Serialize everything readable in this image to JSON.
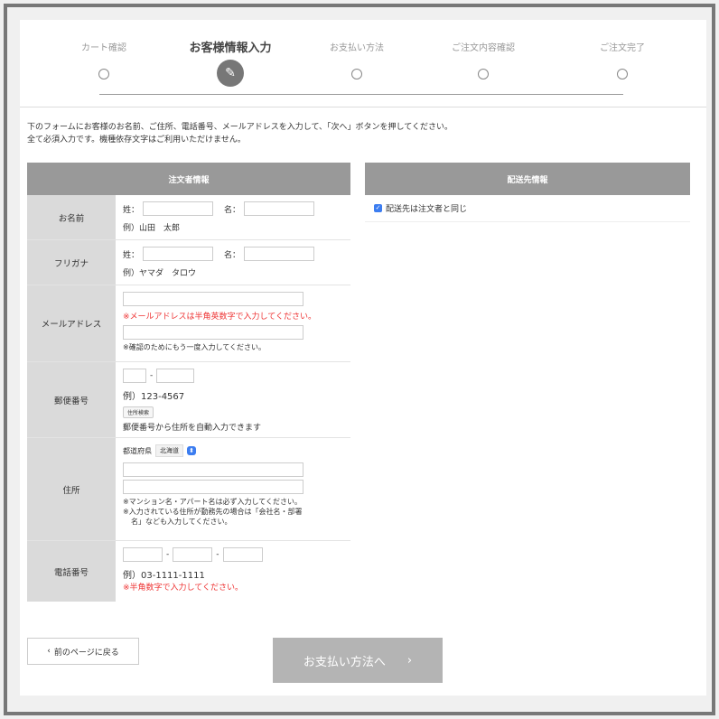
{
  "steps": [
    {
      "label": "カート確認"
    },
    {
      "label": "お客様情報入力"
    },
    {
      "label": "お支払い方法"
    },
    {
      "label": "ご注文内容確認"
    },
    {
      "label": "ご注文完了"
    }
  ],
  "intro": {
    "line1": "下のフォームにお客様のお名前、ご住所、電話番号、メールアドレスを入力して、「次へ」ボタンを押してください。",
    "line2": "全て必須入力です。機種依存文字はご利用いただけません。"
  },
  "orderer": {
    "header": "注文者情報",
    "name": {
      "label": "お名前",
      "sei": "姓：",
      "mei": "名：",
      "example": "例）山田　太郎"
    },
    "kana": {
      "label": "フリガナ",
      "sei": "姓：",
      "mei": "名：",
      "example": "例）ヤマダ　タロウ"
    },
    "email": {
      "label": "メールアドレス",
      "note": "※メールアドレスは半角英数字で入力してください。",
      "confirm_note": "※確認のためにもう一度入力してください。"
    },
    "zip": {
      "label": "郵便番号",
      "dash": "-",
      "example": "例）123-4567",
      "search_button": "住所検索",
      "note": "郵便番号から住所を自動入力できます"
    },
    "address": {
      "label": "住所",
      "pref_label": "都道府県",
      "pref_value": "北海道",
      "note1": "※マンション名・アパート名は必ず入力してください。",
      "note2": "※入力されている住所が勤務先の場合は「会社名・部署",
      "note3": "名」なども入力してください。"
    },
    "phone": {
      "label": "電話番号",
      "dash": "-",
      "example": "例）03-1111-1111",
      "note": "※半角数字で入力してください。"
    }
  },
  "shipping": {
    "header": "配送先情報",
    "same_label": "配送先は注文者と同じ"
  },
  "nav": {
    "back_label": "前のページに戻る",
    "back_icon": "‹",
    "next_label": "お支払い方法へ",
    "next_icon": "›"
  },
  "icons": {
    "pen": "✎",
    "check": "✓",
    "chevron": "⬍"
  },
  "colors": {
    "accent": "#3c7df0",
    "header_gray": "#999999",
    "label_gray": "#dadada",
    "error": "#e33333"
  }
}
